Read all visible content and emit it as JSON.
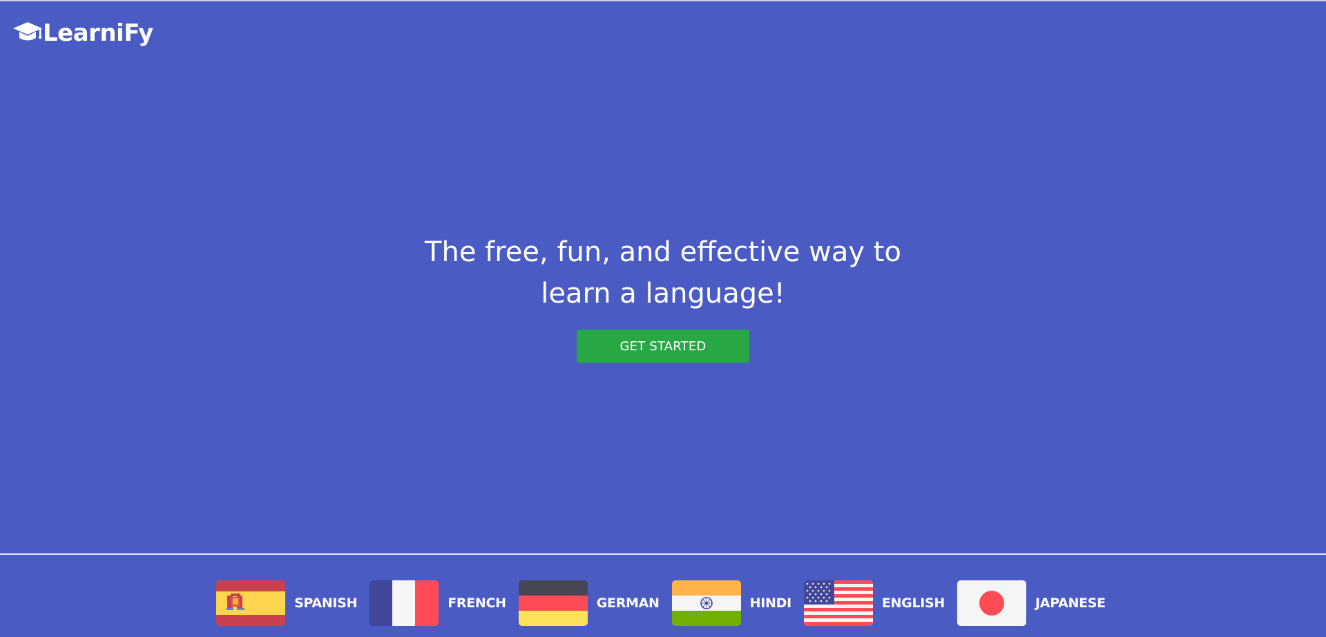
{
  "brand": {
    "name": "LearniFy",
    "icon": "graduation-cap-icon"
  },
  "hero": {
    "headline_line1": "The free, fun, and effective way to",
    "headline_line2": "learn a language!",
    "cta_label": "GET STARTED"
  },
  "languages": [
    {
      "label": "SPANISH",
      "flag": "spain-flag-icon"
    },
    {
      "label": "FRENCH",
      "flag": "france-flag-icon"
    },
    {
      "label": "GERMAN",
      "flag": "germany-flag-icon"
    },
    {
      "label": "HINDI",
      "flag": "india-flag-icon"
    },
    {
      "label": "ENGLISH",
      "flag": "usa-flag-icon"
    },
    {
      "label": "JAPANESE",
      "flag": "japan-flag-icon"
    }
  ],
  "colors": {
    "background": "#4b5bc4",
    "cta": "#28a745",
    "text": "#ffffff"
  }
}
